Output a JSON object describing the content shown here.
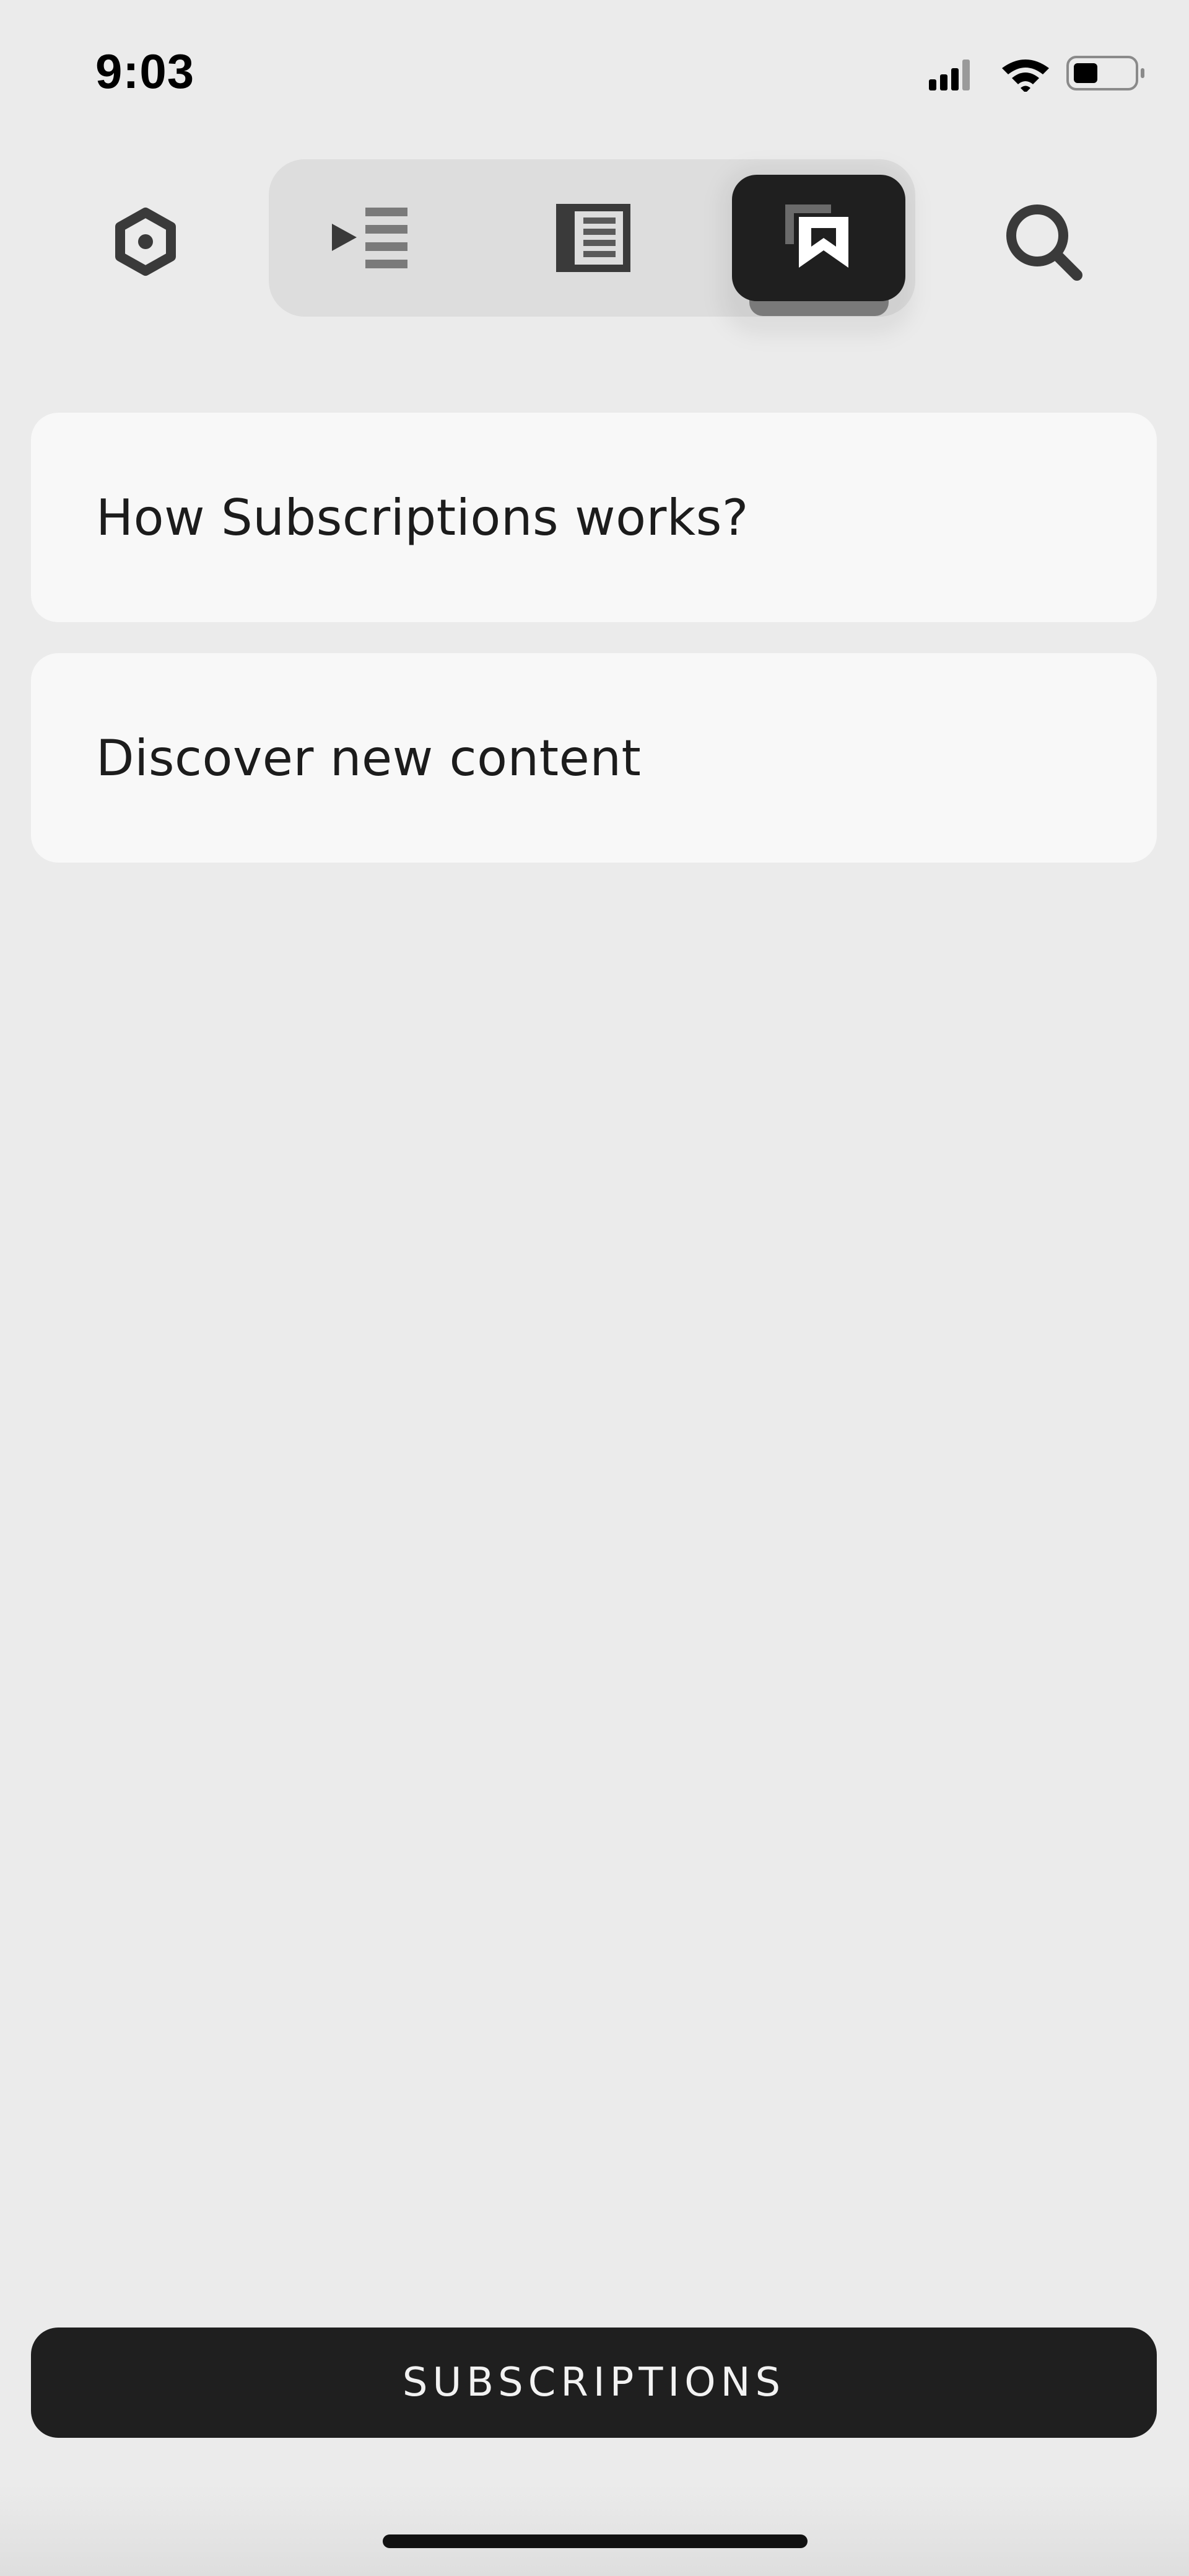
{
  "status_bar": {
    "time": "9:03",
    "icons": [
      "signal-icon",
      "wifi-icon",
      "battery-icon"
    ]
  },
  "nav": {
    "settings_icon": "hexagon-settings-icon",
    "tabs": [
      {
        "name": "queue",
        "icon": "play-list-icon",
        "active": false
      },
      {
        "name": "articles",
        "icon": "document-list-icon",
        "active": false
      },
      {
        "name": "subscriptions",
        "icon": "bookmark-stack-icon",
        "active": true
      }
    ],
    "search_icon": "search-icon"
  },
  "cards": [
    {
      "label": "How Subscriptions works?"
    },
    {
      "label": "Discover new content"
    }
  ],
  "footer": {
    "button_label": "SUBSCRIPTIONS"
  },
  "colors": {
    "background": "#ebebeb",
    "card": "#f8f8f8",
    "dark": "#1f1f1f",
    "segment_bg": "#dddddd"
  }
}
